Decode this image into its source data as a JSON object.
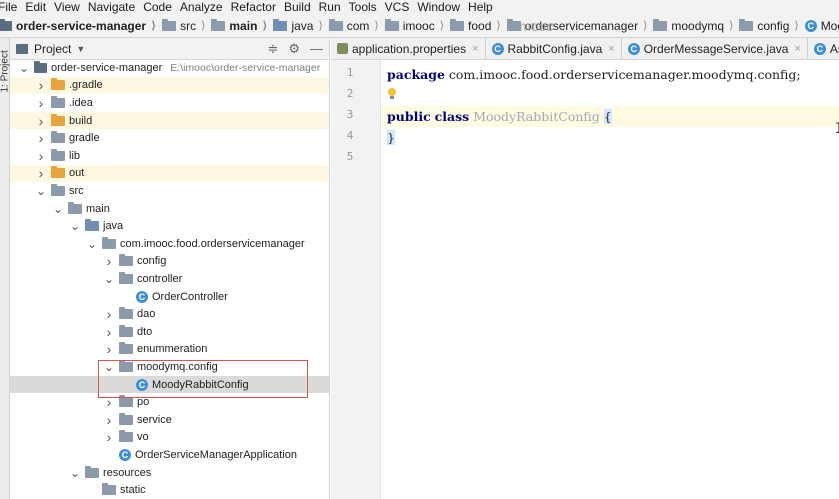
{
  "menu": [
    "File",
    "Edit",
    "View",
    "Navigate",
    "Code",
    "Analyze",
    "Refactor",
    "Build",
    "Run",
    "Tools",
    "VCS",
    "Window",
    "Help"
  ],
  "breadcrumbs": [
    {
      "label": "order-service-manager",
      "icon": "project-folder-icon",
      "bold": true
    },
    {
      "label": "src",
      "icon": "folder-icon",
      "bold": false
    },
    {
      "label": "main",
      "icon": "folder-icon",
      "bold": true
    },
    {
      "label": "java",
      "icon": "source-folder-icon",
      "bold": false
    },
    {
      "label": "com",
      "icon": "package-icon",
      "bold": false
    },
    {
      "label": "imooc",
      "icon": "package-icon",
      "bold": false
    },
    {
      "label": "food",
      "icon": "package-icon",
      "bold": false
    },
    {
      "label": "orderservicemanager",
      "icon": "package-icon",
      "bold": false
    },
    {
      "label": "moodymq",
      "icon": "package-icon",
      "bold": false
    },
    {
      "label": "config",
      "icon": "package-icon",
      "bold": false
    },
    {
      "label": "MoodyRabbitConfig",
      "icon": "class-icon",
      "bold": false
    }
  ],
  "watermark": "imooc",
  "side_strip_label": "1: Project",
  "project_panel": {
    "title": "Project",
    "tree": [
      {
        "label": "order-service-manager",
        "path": "E:\\imooc\\order-service-manager",
        "depth": 0,
        "expanded": true,
        "icon": "project",
        "style": ""
      },
      {
        "label": ".gradle",
        "depth": 1,
        "expanded": false,
        "icon": "folder-orange",
        "style": "ignored"
      },
      {
        "label": ".idea",
        "depth": 1,
        "expanded": false,
        "icon": "folder",
        "style": ""
      },
      {
        "label": "build",
        "depth": 1,
        "expanded": false,
        "icon": "folder-orange",
        "style": "ignored"
      },
      {
        "label": "gradle",
        "depth": 1,
        "expanded": false,
        "icon": "folder",
        "style": ""
      },
      {
        "label": "lib",
        "depth": 1,
        "expanded": false,
        "icon": "folder",
        "style": ""
      },
      {
        "label": "out",
        "depth": 1,
        "expanded": false,
        "icon": "folder-orange",
        "style": "ignored"
      },
      {
        "label": "src",
        "depth": 1,
        "expanded": true,
        "icon": "folder",
        "style": ""
      },
      {
        "label": "main",
        "depth": 2,
        "expanded": true,
        "icon": "folder",
        "style": ""
      },
      {
        "label": "java",
        "depth": 3,
        "expanded": true,
        "icon": "folder-blue",
        "style": ""
      },
      {
        "label": "com.imooc.food.orderservicemanager",
        "depth": 4,
        "expanded": true,
        "icon": "folder",
        "style": ""
      },
      {
        "label": "config",
        "depth": 5,
        "expanded": false,
        "icon": "folder",
        "style": ""
      },
      {
        "label": "controller",
        "depth": 5,
        "expanded": true,
        "icon": "folder",
        "style": ""
      },
      {
        "label": "OrderController",
        "depth": 6,
        "expanded": null,
        "icon": "class",
        "style": ""
      },
      {
        "label": "dao",
        "depth": 5,
        "expanded": false,
        "icon": "folder",
        "style": ""
      },
      {
        "label": "dto",
        "depth": 5,
        "expanded": false,
        "icon": "folder",
        "style": ""
      },
      {
        "label": "enummeration",
        "depth": 5,
        "expanded": false,
        "icon": "folder",
        "style": ""
      },
      {
        "label": "moodymq.config",
        "depth": 5,
        "expanded": true,
        "icon": "folder",
        "style": ""
      },
      {
        "label": "MoodyRabbitConfig",
        "depth": 6,
        "expanded": null,
        "icon": "class",
        "style": "selected"
      },
      {
        "label": "po",
        "depth": 5,
        "expanded": false,
        "icon": "folder",
        "style": ""
      },
      {
        "label": "service",
        "depth": 5,
        "expanded": false,
        "icon": "folder",
        "style": ""
      },
      {
        "label": "vo",
        "depth": 5,
        "expanded": false,
        "icon": "folder",
        "style": ""
      },
      {
        "label": "OrderServiceManagerApplication",
        "depth": 5,
        "expanded": null,
        "icon": "class",
        "style": ""
      },
      {
        "label": "resources",
        "depth": 3,
        "expanded": true,
        "icon": "folder",
        "style": ""
      },
      {
        "label": "static",
        "depth": 4,
        "expanded": null,
        "icon": "folder",
        "style": ""
      }
    ]
  },
  "editor": {
    "tabs": [
      {
        "label": "application.properties",
        "icon": "properties-icon",
        "active": false
      },
      {
        "label": "RabbitConfig.java",
        "icon": "class-icon",
        "active": false
      },
      {
        "label": "OrderMessageService.java",
        "icon": "class-icon",
        "active": false
      },
      {
        "label": "AsyncTask",
        "icon": "class-icon",
        "active": false
      }
    ],
    "line_numbers": [
      "1",
      "2",
      "3",
      "4",
      "5"
    ],
    "code": {
      "line1_kw": "package",
      "line1_rest": " com.imooc.food.orderservicemanager.moodymq.config;",
      "line3_kw1": "public",
      "line3_kw2": "class",
      "line3_class": "MoodyRabbitConfig",
      "line3_brace": "{",
      "line4_brace": "}"
    }
  },
  "colors": {
    "keyword": "#000080",
    "highlight_box": "#d9534f",
    "ignored_row": "#fdf8e2",
    "selected_row": "#dadada"
  }
}
